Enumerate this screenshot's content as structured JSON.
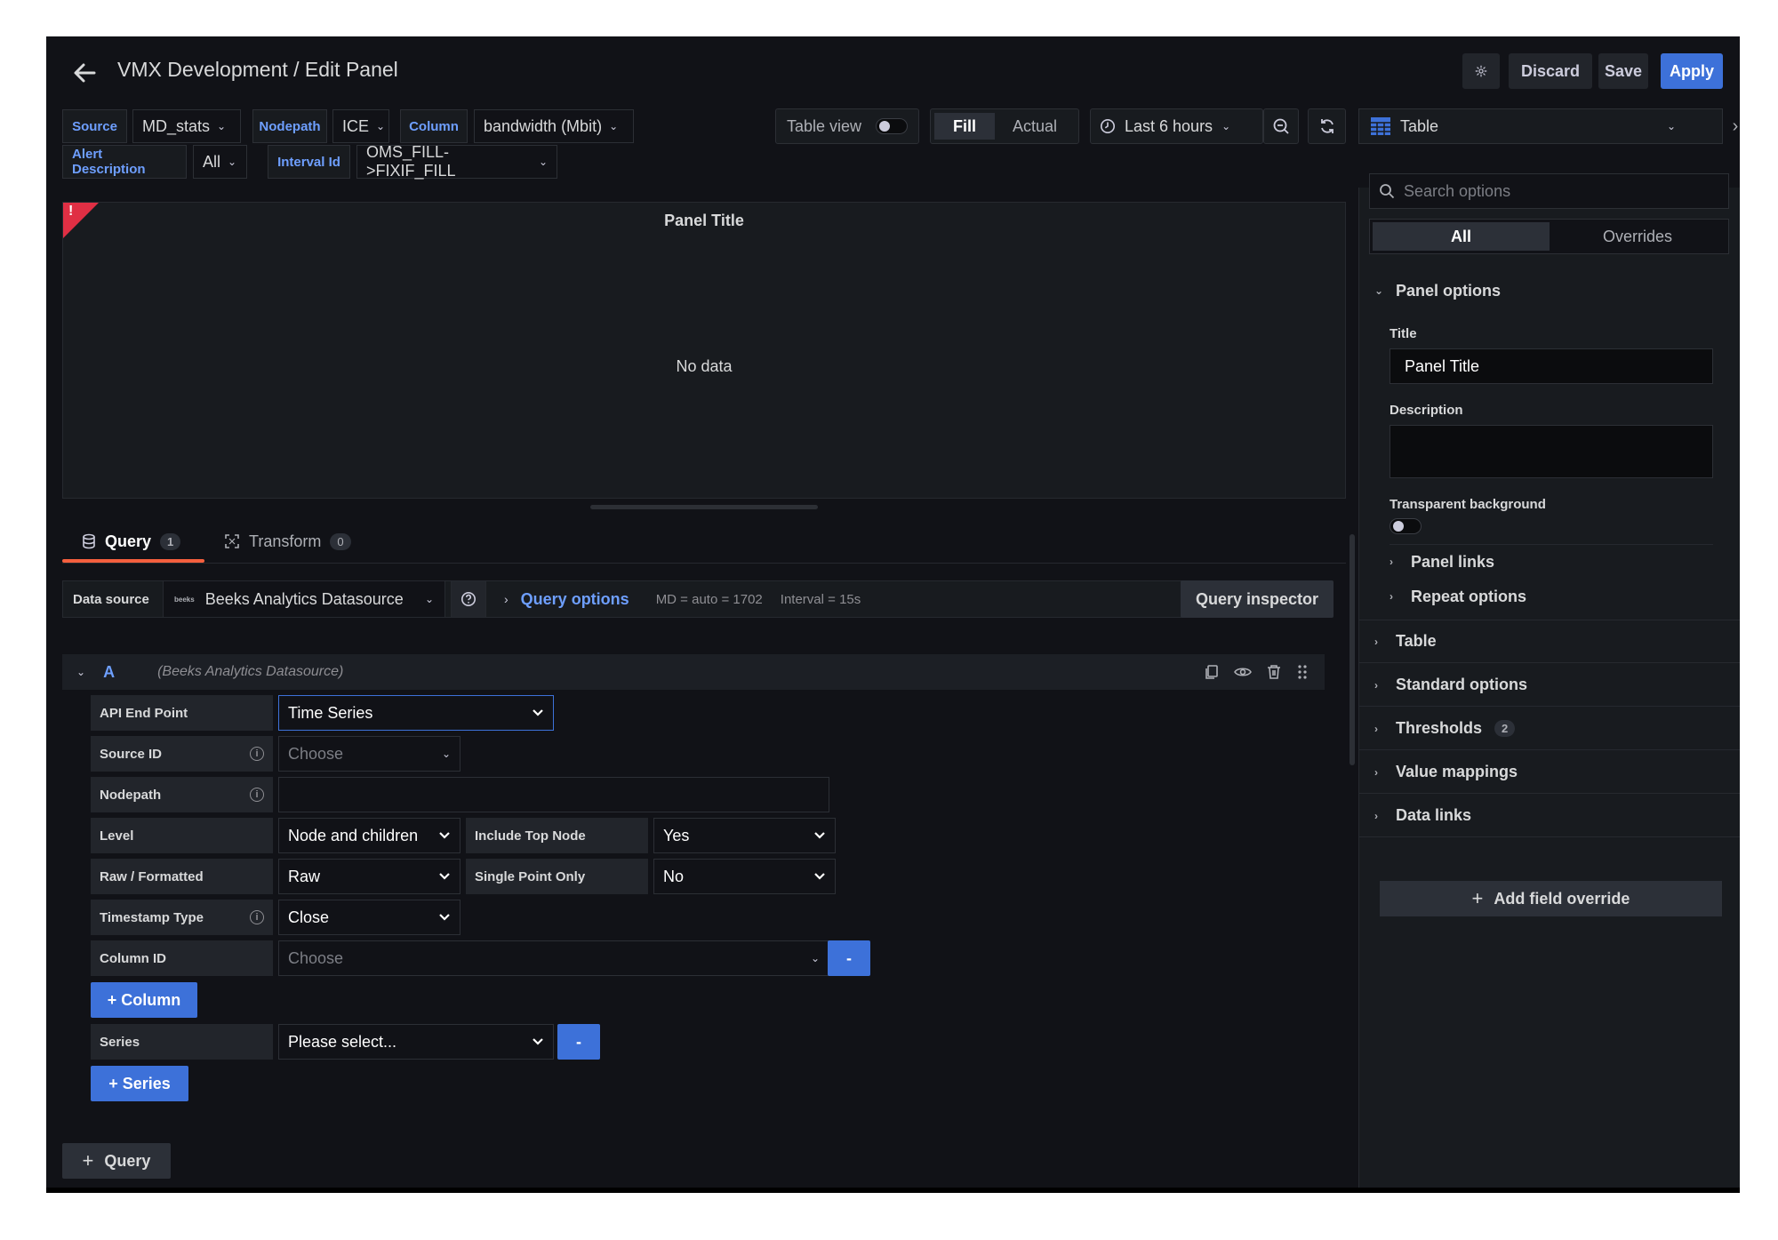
{
  "header": {
    "title": "VMX Development / Edit Panel",
    "discard_label": "Discard",
    "save_label": "Save",
    "apply_label": "Apply"
  },
  "variables": {
    "row1": [
      {
        "label": "Source",
        "value": "MD_stats"
      },
      {
        "label": "Nodepath",
        "value": "ICE"
      },
      {
        "label": "Column",
        "value": "bandwidth (Mbit)"
      }
    ],
    "row2": [
      {
        "label": "Alert Description",
        "value": "All"
      },
      {
        "label": "Interval Id",
        "value": "OMS_FILL->FIXIF_FILL"
      }
    ]
  },
  "toolbar": {
    "table_view_label": "Table view",
    "fill_label": "Fill",
    "actual_label": "Actual",
    "time_range": "Last 6 hours"
  },
  "panel": {
    "title": "Panel Title",
    "empty_text": "No data",
    "error_mark": "!"
  },
  "tabs": [
    {
      "label": "Query",
      "count": "1"
    },
    {
      "label": "Transform",
      "count": "0"
    }
  ],
  "query": {
    "datasource_label": "Data source",
    "datasource_value": "Beeks Analytics Datasource",
    "datasource_logo_text": "beeks",
    "query_options_label": "Query options",
    "query_options_md": "MD = auto = 1702",
    "query_options_interval": "Interval = 15s",
    "inspector_label": "Query inspector",
    "row_letter": "A",
    "row_datasource": "(Beeks Analytics Datasource)",
    "fields": {
      "api_end_point_label": "API End Point",
      "api_end_point_value": "Time Series",
      "source_id_label": "Source ID",
      "source_id_placeholder": "Choose",
      "nodepath_label": "Nodepath",
      "nodepath_value": "",
      "level_label": "Level",
      "level_value": "Node and children",
      "include_top_label": "Include Top Node",
      "include_top_value": "Yes",
      "raw_label": "Raw / Formatted",
      "raw_value": "Raw",
      "single_point_label": "Single Point Only",
      "single_point_value": "No",
      "timestamp_label": "Timestamp Type",
      "timestamp_value": "Close",
      "column_id_label": "Column ID",
      "column_id_placeholder": "Choose",
      "minus_label": "-",
      "add_column_label": "+ Column",
      "series_label": "Series",
      "series_value": "Please select...",
      "add_series_label": "+ Series"
    },
    "add_query_label": "Query"
  },
  "sidebar": {
    "viz_type": "Table",
    "search_placeholder": "Search options",
    "tab_all": "All",
    "tab_overrides": "Overrides",
    "panel_options": "Panel options",
    "title_label": "Title",
    "title_value": "Panel Title",
    "description_label": "Description",
    "transparent_label": "Transparent background",
    "panel_links": "Panel links",
    "repeat_options": "Repeat options",
    "sections": [
      {
        "label": "Table"
      },
      {
        "label": "Standard options"
      },
      {
        "label": "Thresholds",
        "badge": "2"
      },
      {
        "label": "Value mappings"
      },
      {
        "label": "Data links"
      }
    ],
    "add_override_label": "Add field override"
  },
  "colors": {
    "background": "#111217",
    "panel": "#181b1f",
    "accent_blue": "#3d71d9",
    "tab_underline": "#f55f3e",
    "error_red": "#e02f44",
    "variable_label": "#6e9fff"
  }
}
